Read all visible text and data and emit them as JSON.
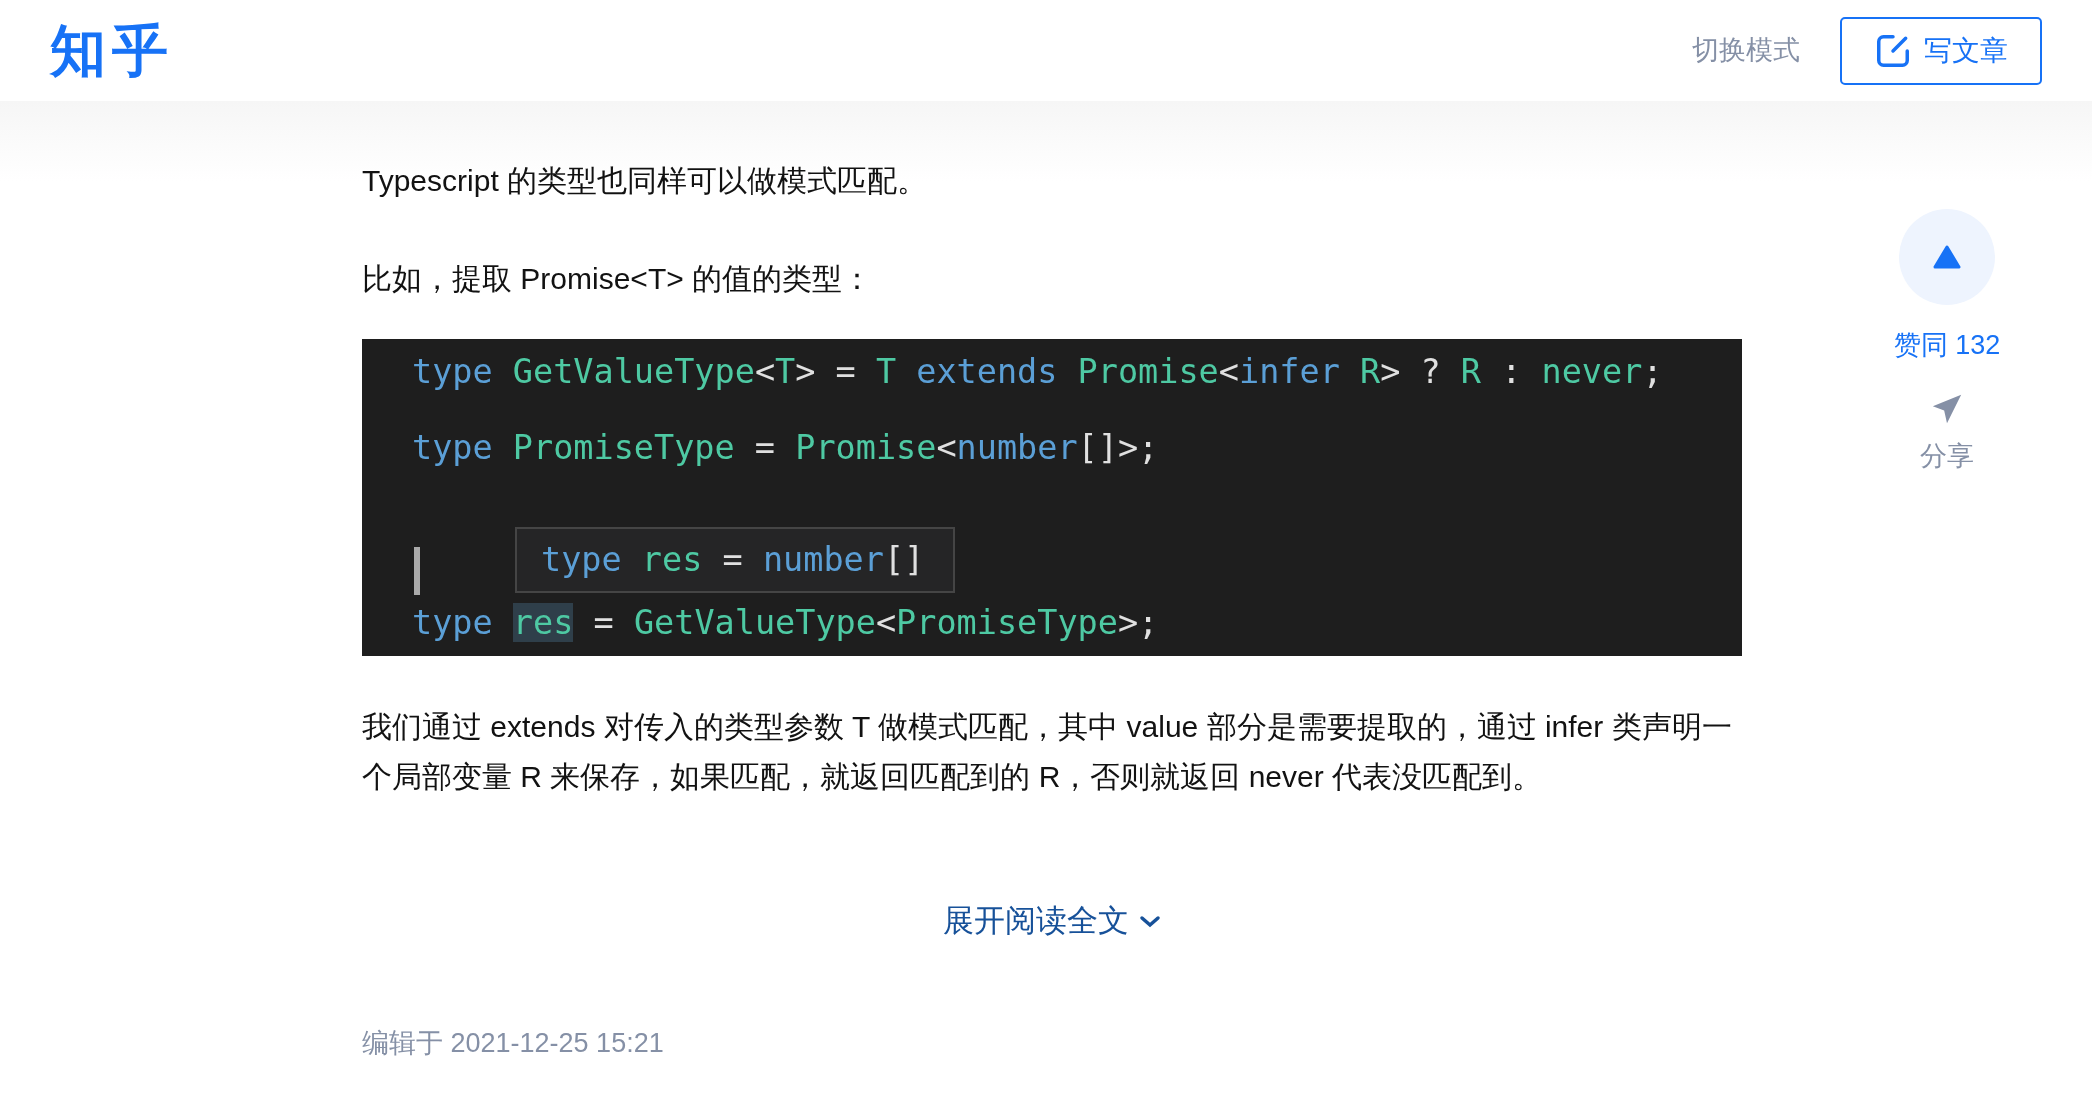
{
  "header": {
    "logo": "知乎",
    "mode_switch": "切换模式",
    "write_button": "写文章"
  },
  "article": {
    "paragraphs_top": [
      "Typescript 的类型也同样可以做模式匹配。",
      "比如，提取 Promise<T> 的值的类型："
    ],
    "code": {
      "lines": [
        [
          {
            "kind": "keyword",
            "text": "type "
          },
          {
            "kind": "type",
            "text": "GetValueType"
          },
          {
            "kind": "plain",
            "text": "<"
          },
          {
            "kind": "type",
            "text": "T"
          },
          {
            "kind": "plain",
            "text": "> = "
          },
          {
            "kind": "type",
            "text": "T "
          },
          {
            "kind": "keyword",
            "text": "extends "
          },
          {
            "kind": "type",
            "text": "Promise"
          },
          {
            "kind": "plain",
            "text": "<"
          },
          {
            "kind": "keyword",
            "text": "infer "
          },
          {
            "kind": "type",
            "text": "R"
          },
          {
            "kind": "plain",
            "text": "> ? "
          },
          {
            "kind": "type",
            "text": "R"
          },
          {
            "kind": "plain",
            "text": " : "
          },
          {
            "kind": "type",
            "text": "never"
          },
          {
            "kind": "plain",
            "text": ";"
          }
        ],
        [
          {
            "kind": "keyword",
            "text": "type "
          },
          {
            "kind": "type",
            "text": "PromiseType"
          },
          {
            "kind": "plain",
            "text": " = "
          },
          {
            "kind": "type",
            "text": "Promise"
          },
          {
            "kind": "plain",
            "text": "<"
          },
          {
            "kind": "keyword",
            "text": "number"
          },
          {
            "kind": "plain",
            "text": "[]>;"
          }
        ],
        [
          {
            "kind": "keyword",
            "text": "type "
          },
          {
            "kind": "highlight",
            "text": "res"
          },
          {
            "kind": "plain",
            "text": " = "
          },
          {
            "kind": "type",
            "text": "GetValueType"
          },
          {
            "kind": "plain",
            "text": "<"
          },
          {
            "kind": "type",
            "text": "PromiseType"
          },
          {
            "kind": "plain",
            "text": ">;"
          }
        ]
      ],
      "tooltip": [
        {
          "kind": "keyword",
          "text": "type "
        },
        {
          "kind": "type",
          "text": "res"
        },
        {
          "kind": "plain",
          "text": " = "
        },
        {
          "kind": "keyword",
          "text": "number"
        },
        {
          "kind": "plain",
          "text": "[]"
        }
      ]
    },
    "paragraphs_bottom": [
      "我们通过 extends 对传入的类型参数 T 做模式匹配，其中 value 部分是需要提取的，通过 infer 类声明一个局部变量 R 来保存，如果匹配，就返回匹配到的 R，否则就返回 never 代表没匹配到。"
    ],
    "expand_link": "展开阅读全文",
    "edited": "编辑于 2021-12-25 15:21"
  },
  "actions": {
    "vote_label": "赞同 132",
    "share_label": "分享"
  }
}
